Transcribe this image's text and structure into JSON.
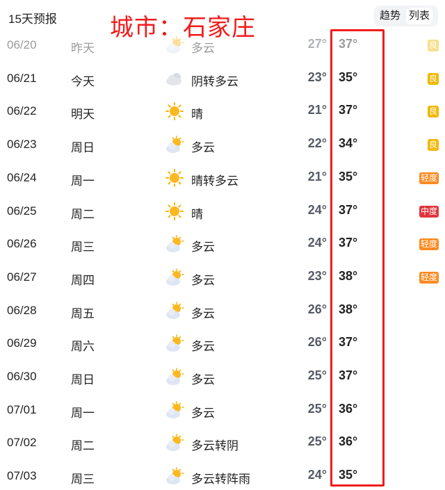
{
  "header": {
    "title": "15天预报",
    "city_annotation": "城市：石家庄",
    "toggle": [
      "趋势",
      "列表"
    ]
  },
  "colors": {
    "good": "#f0b800",
    "light": "#fb8b23",
    "moderate": "#e0353d",
    "annotation": "#f21b1b"
  },
  "rows": [
    {
      "date": "06/20",
      "day": "昨天",
      "icon": "partly-cloudy",
      "desc": "多云",
      "low": "27°",
      "high": "37°",
      "aqi": "良",
      "level": "good",
      "past": true
    },
    {
      "date": "06/21",
      "day": "今天",
      "icon": "cloudy",
      "desc": "阴转多云",
      "low": "23°",
      "high": "35°",
      "aqi": "良",
      "level": "good"
    },
    {
      "date": "06/22",
      "day": "明天",
      "icon": "sunny",
      "desc": "晴",
      "low": "21°",
      "high": "37°",
      "aqi": "良",
      "level": "good"
    },
    {
      "date": "06/23",
      "day": "周日",
      "icon": "partly-cloudy",
      "desc": "多云",
      "low": "22°",
      "high": "34°",
      "aqi": "良",
      "level": "good"
    },
    {
      "date": "06/24",
      "day": "周一",
      "icon": "sunny",
      "desc": "晴转多云",
      "low": "21°",
      "high": "35°",
      "aqi": "轻度",
      "level": "light"
    },
    {
      "date": "06/25",
      "day": "周二",
      "icon": "sunny",
      "desc": "晴",
      "low": "24°",
      "high": "37°",
      "aqi": "中度",
      "level": "moderate"
    },
    {
      "date": "06/26",
      "day": "周三",
      "icon": "partly-cloudy",
      "desc": "多云",
      "low": "24°",
      "high": "37°",
      "aqi": "轻度",
      "level": "light"
    },
    {
      "date": "06/27",
      "day": "周四",
      "icon": "partly-cloudy",
      "desc": "多云",
      "low": "23°",
      "high": "38°",
      "aqi": "轻度",
      "level": "light"
    },
    {
      "date": "06/28",
      "day": "周五",
      "icon": "partly-cloudy",
      "desc": "多云",
      "low": "26°",
      "high": "38°"
    },
    {
      "date": "06/29",
      "day": "周六",
      "icon": "partly-cloudy",
      "desc": "多云",
      "low": "26°",
      "high": "37°"
    },
    {
      "date": "06/30",
      "day": "周日",
      "icon": "partly-cloudy",
      "desc": "多云",
      "low": "25°",
      "high": "37°"
    },
    {
      "date": "07/01",
      "day": "周一",
      "icon": "partly-cloudy",
      "desc": "多云",
      "low": "25°",
      "high": "36°"
    },
    {
      "date": "07/02",
      "day": "周二",
      "icon": "partly-cloudy",
      "desc": "多云转阴",
      "low": "25°",
      "high": "36°"
    },
    {
      "date": "07/03",
      "day": "周三",
      "icon": "partly-cloudy",
      "desc": "多云转阵雨",
      "low": "24°",
      "high": "35°"
    }
  ]
}
